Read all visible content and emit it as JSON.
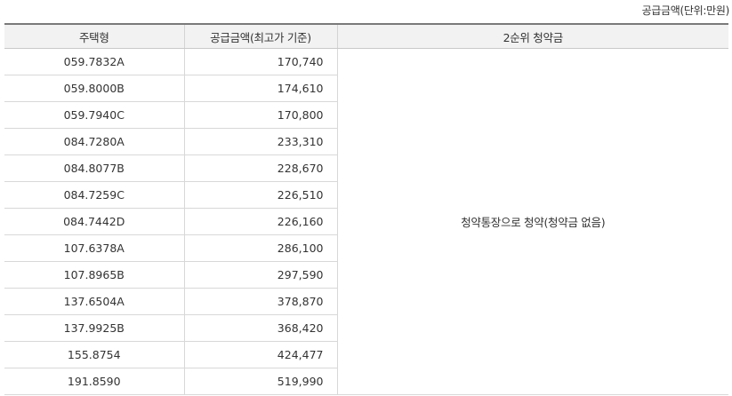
{
  "unit_note": "공급금액(단위:만원)",
  "table": {
    "headers": [
      "주택형",
      "공급금액(최고가 기준)",
      "2순위 청약금"
    ],
    "deposit_note": "청약통장으로 청약(청약금 없음)",
    "rows": [
      {
        "type": "059.7832A",
        "price": "170,740"
      },
      {
        "type": "059.8000B",
        "price": "174,610"
      },
      {
        "type": "059.7940C",
        "price": "170,800"
      },
      {
        "type": "084.7280A",
        "price": "233,310"
      },
      {
        "type": "084.8077B",
        "price": "228,670"
      },
      {
        "type": "084.7259C",
        "price": "226,510"
      },
      {
        "type": "084.7442D",
        "price": "226,160"
      },
      {
        "type": "107.6378A",
        "price": "286,100"
      },
      {
        "type": "107.8965B",
        "price": "297,590"
      },
      {
        "type": "137.6504A",
        "price": "378,870"
      },
      {
        "type": "137.9925B",
        "price": "368,420"
      },
      {
        "type": "155.8754",
        "price": "424,477"
      },
      {
        "type": "191.8590",
        "price": "519,990"
      }
    ]
  }
}
